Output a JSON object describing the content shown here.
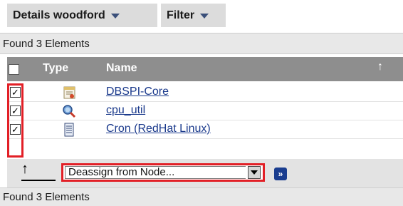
{
  "tabs": {
    "details_label": "Details woodford",
    "filter_label": "Filter"
  },
  "found_top": "Found 3 Elements",
  "found_bottom": "Found 3 Elements",
  "table": {
    "headers": {
      "type": "Type",
      "name": "Name"
    },
    "rows": [
      {
        "name": "DBSPI-Core",
        "checked": true,
        "icon": "policy-icon"
      },
      {
        "name": "cpu_util",
        "checked": true,
        "icon": "monitor-magnifier-icon"
      },
      {
        "name": "Cron (RedHat Linux)",
        "checked": true,
        "icon": "document-icon"
      }
    ]
  },
  "actions": {
    "selected": "Deassign from Node...",
    "go_label": "»"
  },
  "colors": {
    "header_bg": "#8e8e8e",
    "highlight": "#e21f26",
    "link": "#1b3a8c"
  }
}
